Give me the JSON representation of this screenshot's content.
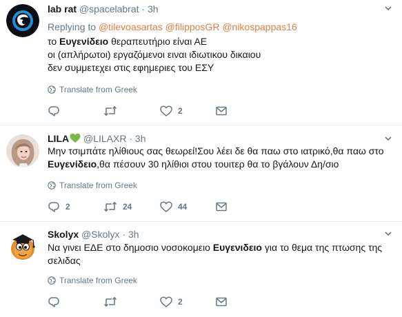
{
  "colors": {
    "mention": "#e0813f",
    "meta_text": "#657786",
    "body_text": "#14171a",
    "divider": "#e6ecf0"
  },
  "translate_label": "Translate from Greek",
  "tweets": [
    {
      "fullname": "lab rat",
      "handle": "@spacelabrat",
      "dot": "·",
      "time": "3h",
      "avatar_icon": "lab-rat-avatar",
      "reply_prefix": "Replying to",
      "reply_to": [
        "@tilevoasartas",
        "@filipposGR",
        "@nikospappas16"
      ],
      "lines": [
        {
          "pre": "το ",
          "kw": "Ευγενίδειο",
          "post": " θεραπευτήριο είναι ΑΕ"
        },
        {
          "pre": "οι (απλήρωτοι) εργαζόμενοι ειναι ιδιωτικου δικαιου",
          "kw": "",
          "post": ""
        },
        {
          "pre": "δεν συμμετεχει στις εφημεριες του ΕΣΥ",
          "kw": "",
          "post": ""
        }
      ],
      "replies": "",
      "retweets": "",
      "likes": "2"
    },
    {
      "fullname": "LILA",
      "emoji": "💚",
      "handle": "@LILAXR",
      "dot": "·",
      "time": "3h",
      "avatar_icon": "woman-photo-avatar",
      "lines": [
        {
          "pre": "Μην τσιμπάτε ηλίθιους σας θεωρεί!Σου λέει δε θα παω στο ιατρικό,θα παω στο",
          "kw": "",
          "post": ""
        },
        {
          "pre": "",
          "kw": "Ευγενίδειο",
          "post": ",θα πέσουν 30 ηλίθιοι στου τουιτερ θα το βγάλουν Δη/σιο"
        }
      ],
      "replies": "2",
      "retweets": "24",
      "likes": "44"
    },
    {
      "fullname": "Skolyx",
      "handle": "@Skolyx",
      "dot": "·",
      "time": "3h",
      "avatar_icon": "cartoon-character-avatar",
      "lines": [
        {
          "pre": "Να γινει ΕΔΕ στο δημοσιο νοσοκομειο ",
          "kw": "Ευγενιδειο",
          "post": " για το θεμα της πτωσης της"
        },
        {
          "pre": "σελιδας",
          "kw": "",
          "post": ""
        }
      ],
      "replies": "",
      "retweets": "",
      "likes": "2"
    }
  ]
}
